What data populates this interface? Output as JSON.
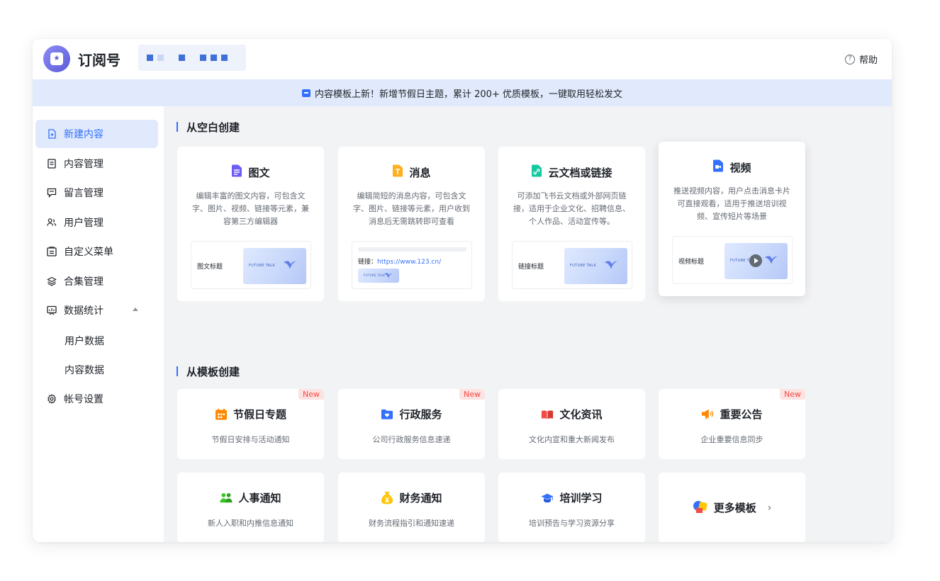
{
  "header": {
    "app_title": "订阅号",
    "help_label": "帮助",
    "help_icon_glyph": "?"
  },
  "banner": {
    "text": "内容模板上新！新增节假日主题，累计 200+ 优质模板，一键取用轻松发文"
  },
  "sidebar": {
    "items": [
      {
        "label": "新建内容",
        "icon": "new-doc-icon",
        "active": true
      },
      {
        "label": "内容管理",
        "icon": "document-icon"
      },
      {
        "label": "留言管理",
        "icon": "comment-icon"
      },
      {
        "label": "用户管理",
        "icon": "users-icon"
      },
      {
        "label": "自定义菜单",
        "icon": "menu-icon"
      },
      {
        "label": "合集管理",
        "icon": "layers-icon"
      },
      {
        "label": "数据统计",
        "icon": "chart-icon",
        "expanded": true
      },
      {
        "label": "帐号设置",
        "icon": "gear-icon"
      }
    ],
    "subitems": [
      {
        "label": "用户数据"
      },
      {
        "label": "内容数据"
      }
    ]
  },
  "blank_section": {
    "title": "从空白创建",
    "cards": [
      {
        "title": "图文",
        "desc": "编辑丰富的图文内容，可包含文字、图片、视频、链接等元素，兼容第三方编辑器",
        "preview_label": "图文标题",
        "thumb_text": "FUTURE TALK"
      },
      {
        "title": "消息",
        "desc": "编辑简短的消息内容，可包含文字、图片、链接等元素，用户收到消息后无需跳转即可查看",
        "link_prefix": "链接：",
        "link_url": "https://www.123.cn/",
        "thumb_text": "FUTURE TALK"
      },
      {
        "title": "云文档或链接",
        "desc": "可添加飞书云文档或外部网页链接，适用于企业文化、招聘信息、个人作品、活动宣传等。",
        "preview_label": "链接标题",
        "thumb_text": "FUTURE TALK"
      },
      {
        "title": "视频",
        "desc": "推送视频内容，用户点击消息卡片可直接观看，适用于推送培训视频、宣传短片等场景",
        "preview_label": "视频标题",
        "thumb_text": "FUTURE TA"
      }
    ]
  },
  "template_section": {
    "title": "从模板创建",
    "cards": [
      {
        "title": "节假日专题",
        "desc": "节假日安排与活动通知",
        "badge": "New",
        "icon": "calendar-icon"
      },
      {
        "title": "行政服务",
        "desc": "公司行政服务信息速递",
        "badge": "New",
        "icon": "folder-heart-icon"
      },
      {
        "title": "文化资讯",
        "desc": "文化内宣和重大新闻发布",
        "icon": "book-icon"
      },
      {
        "title": "重要公告",
        "desc": "企业重要信息同步",
        "badge": "New",
        "icon": "megaphone-icon"
      },
      {
        "title": "人事通知",
        "desc": "新人入职和内推信息通知",
        "icon": "people-icon"
      },
      {
        "title": "财务通知",
        "desc": "财务流程指引和通知速递",
        "icon": "money-bag-icon"
      },
      {
        "title": "培训学习",
        "desc": "培训预告与学习资源分享",
        "icon": "graduation-cap-icon"
      }
    ],
    "more_label": "更多模板",
    "more_chevron": "›"
  },
  "colors": {
    "accent": "#3370ff",
    "banner_bg": "#e1eafc",
    "main_bg": "#f2f3f5",
    "new_badge_bg": "#fde2e2",
    "new_badge_text": "#f54a45"
  }
}
